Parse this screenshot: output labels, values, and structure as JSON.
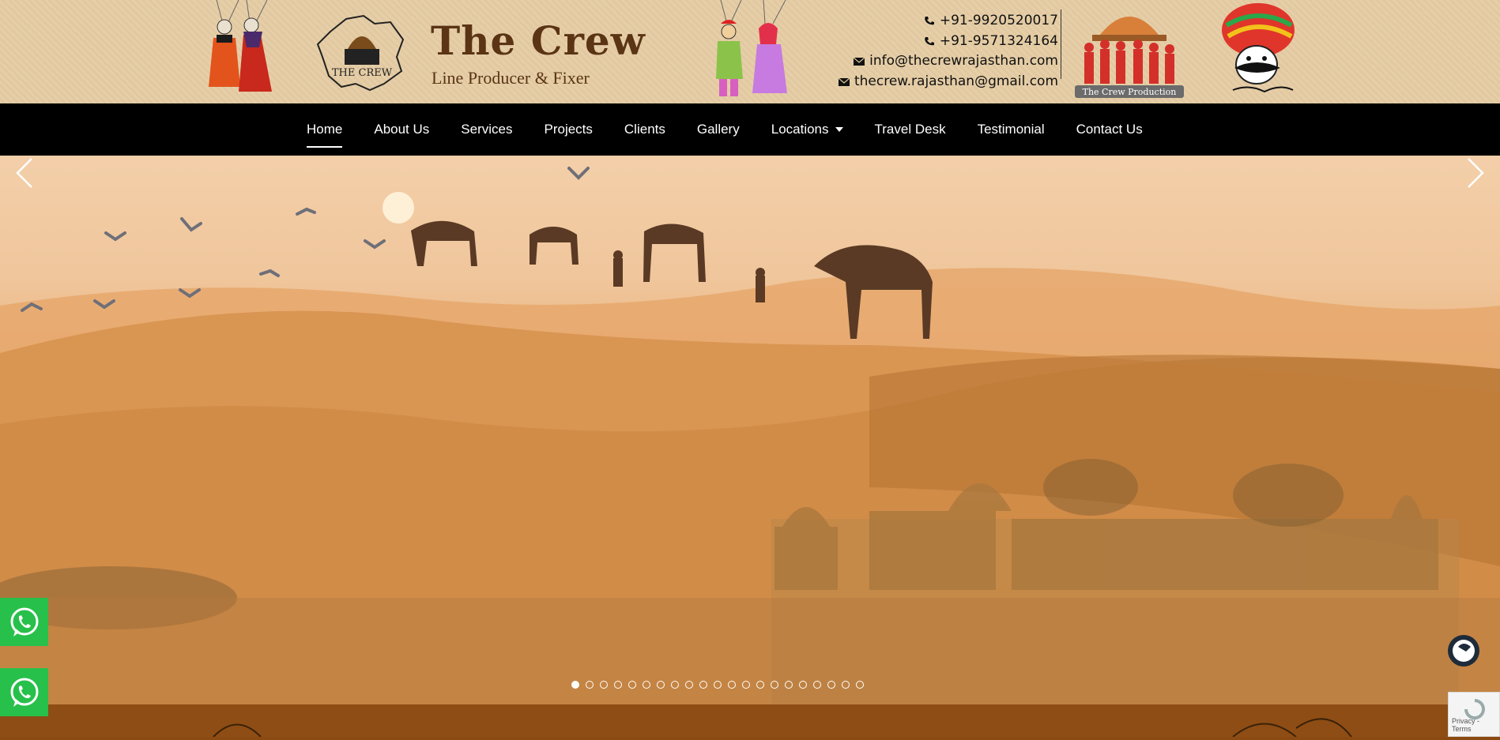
{
  "header": {
    "brand_title": "The Crew",
    "brand_subtitle": "Line Producer & Fixer",
    "logo_text": "THE CREW",
    "production_logo_text": "The Crew Production",
    "contacts": {
      "phone_1": "+91-9920520017",
      "phone_2": "+91-9571324164",
      "email_1": "info@thecrewrajasthan.com",
      "email_2": "thecrew.rajasthan@gmail.com"
    }
  },
  "nav": {
    "items": [
      {
        "label": "Home"
      },
      {
        "label": "About Us"
      },
      {
        "label": "Services"
      },
      {
        "label": "Projects"
      },
      {
        "label": "Clients"
      },
      {
        "label": "Gallery"
      },
      {
        "label": "Locations"
      },
      {
        "label": "Travel Desk"
      },
      {
        "label": "Testimonial"
      },
      {
        "label": "Contact Us"
      }
    ],
    "active": "Home"
  },
  "slider": {
    "slide_count": 21,
    "active_index": 0
  },
  "recaptcha": {
    "text": "Privacy - Terms"
  },
  "colors": {
    "nav_bg": "#000000",
    "header_bg": "#e4cca4",
    "brand_brown": "#5a3415",
    "whatsapp_green": "#27c04a",
    "footer_strip": "#8e4d14"
  },
  "icons": [
    "phone-icon",
    "mail-icon",
    "chevron-left-icon",
    "chevron-right-icon",
    "whatsapp-icon",
    "chat-icon",
    "caret-down-icon"
  ]
}
